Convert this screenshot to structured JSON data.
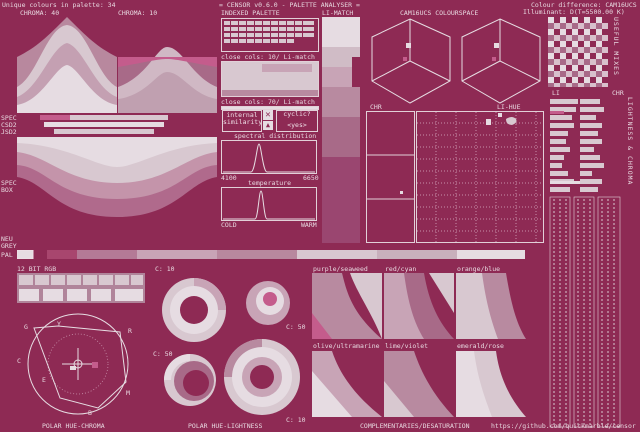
{
  "header": {
    "title": "= CENSOR v0.6.0 - PALETTE ANALYSER =",
    "unique_colours": "Unique colours in palette: 34",
    "colour_difference": "Colour difference: CAM16UCS",
    "illuminant": "Illuminant: D(T=5500.00 K)"
  },
  "labels": {
    "chroma_40": "CHROMA: 40",
    "chroma_10": "CHROMA: 10",
    "indexed_palette": "INDEXED PALETTE",
    "li_match": "LI-MATCH",
    "cam16": "CAM16UCS COLOURSPACE",
    "close_cols_1": "close cols: 10/ Li-match",
    "close_cols_2": "close cols: 70/ Li-match",
    "internal_similarity": "internal similarity",
    "cyclic": "cyclic?",
    "yes": "<yes>",
    "spectral_distribution": "spectral distribution",
    "spec_min": "4100",
    "spec_max": "6650",
    "temperature": "temperature",
    "cold": "COLD",
    "warm": "WARM",
    "chr": "CHR",
    "li_hue": "LI-HUE",
    "li": "LI",
    "chr_right": "CHR",
    "spec": "SPEC",
    "csd2": "CSD2",
    "jsd2": "JSD2",
    "spec_box": "SPEC",
    "box": "BOX",
    "neu": "NEU",
    "grey": "GREY",
    "pal": "PAL",
    "bit12": "12 BIT RGB",
    "c10_a": "C: 10",
    "c50_a": "C: 50",
    "c50_b": "C: 50",
    "c10_b": "C: 10",
    "purple_seaweed": "purple/seaweed",
    "red_cyan": "red/cyan",
    "orange_blue": "orange/blue",
    "olive_ultramarine": "olive/ultramarine",
    "lime_violet": "lime/violet",
    "emerald_rose": "emerald/rose",
    "polar_hue_chroma": "POLAR HUE-CHROMA",
    "polar_hue_lightness": "POLAR HUE-LIGHTNESS",
    "complementaries": "COMPLEMENTARIES/DESATURATION",
    "url": "https://github.com/quickmarble/censor",
    "useful_mixes": "USEFUL MIXES",
    "lightness_chroma": "LIGHTNESS & CHROMA",
    "wheel_g": "G",
    "wheel_y": "Y",
    "wheel_r": "R",
    "wheel_c": "C",
    "wheel_e": "E",
    "wheel_b": "B",
    "wheel_m": "M"
  },
  "colors": {
    "bg": "#8e2a54",
    "light": "#d8c8d0",
    "pale": "#e6dce2",
    "mid": "#b87a98",
    "pink": "#c45c8c",
    "dark": "#6e1e42"
  }
}
